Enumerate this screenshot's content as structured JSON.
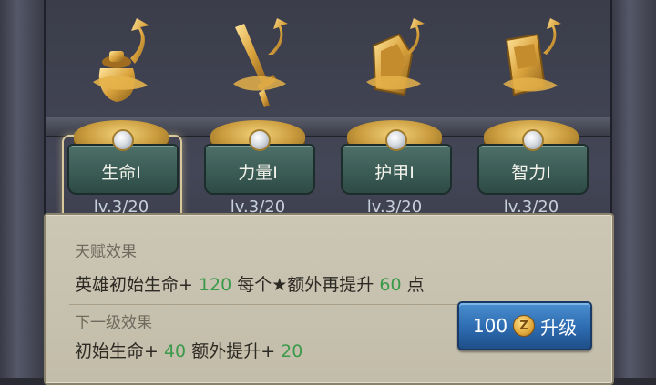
{
  "talents": [
    {
      "name": "生命Ⅰ",
      "level": "lv.3",
      "max": "/20",
      "icon": "potion-jar-icon",
      "selected": true
    },
    {
      "name": "力量Ⅰ",
      "level": "lv.3",
      "max": "/20",
      "icon": "sword-icon",
      "selected": false
    },
    {
      "name": "护甲Ⅰ",
      "level": "lv.3",
      "max": "/20",
      "icon": "shield-icon",
      "selected": false
    },
    {
      "name": "智力Ⅰ",
      "level": "lv.3",
      "max": "/20",
      "icon": "spellbook-icon",
      "selected": false
    }
  ],
  "panel": {
    "talent_effect_title": "天赋效果",
    "current_effect": {
      "prefix": "英雄初始生命+ ",
      "base_value": "120",
      "middle": " 每个★额外再提升 ",
      "extra_value": "60",
      "suffix": " 点"
    },
    "next_level_title": "下一级效果",
    "next_effect": {
      "prefix": "初始生命+ ",
      "base_value": "40",
      "middle": " 额外提升+ ",
      "extra_value": "20"
    }
  },
  "upgrade_button": {
    "cost": "100",
    "coin_symbol": "Z",
    "label": "升级"
  },
  "colors": {
    "highlight_number": "#3b9a4a",
    "button_blue": "#2d6bb0",
    "plate_teal": "#3a5a54",
    "gold": "#c89a3c"
  }
}
